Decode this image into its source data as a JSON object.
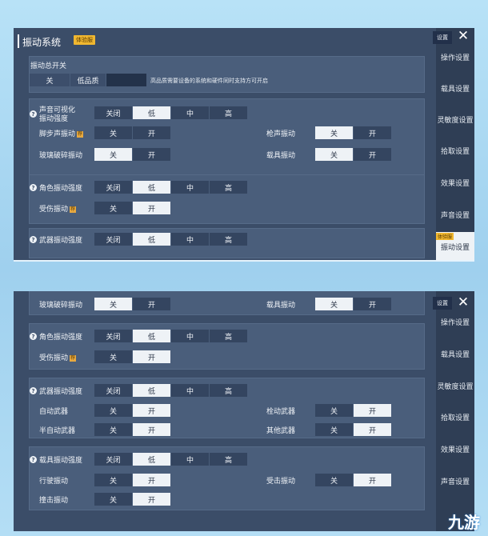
{
  "window": {
    "title": "振动系统",
    "badge": "体验服",
    "close_glyph": "✕"
  },
  "sidebar": {
    "top_button": "设置",
    "new_badge": "体验服",
    "items": [
      "操作设置",
      "载具设置",
      "灵敏度设置",
      "拾取设置",
      "效果设置",
      "声音设置",
      "振动设置"
    ]
  },
  "panel1": {
    "master": {
      "label": "振动总开关",
      "options": [
        "关",
        "低品质"
      ],
      "note": "高品质需要设备的系统和硬件同时支持方可开启"
    },
    "sound_visual": {
      "label_line1": "声音可视化",
      "label_line2": "振动强度",
      "levels": [
        "关闭",
        "低",
        "中",
        "高"
      ],
      "footstep": "脚步声振动",
      "gunshot": "枪声振动",
      "glass": "玻璃破碎振动",
      "vehicle": "载具振动"
    },
    "character": {
      "label": "角色振动强度",
      "levels": [
        "关闭",
        "低",
        "中",
        "高"
      ],
      "hit": "受伤振动"
    },
    "weapon": {
      "label": "武器振动强度",
      "levels": [
        "关闭",
        "低",
        "中",
        "高"
      ]
    }
  },
  "panel2": {
    "top_row": {
      "glass": "玻璃破碎振动",
      "vehicle": "载具振动"
    },
    "character": {
      "label": "角色振动强度",
      "levels": [
        "关闭",
        "低",
        "中",
        "高"
      ],
      "hit": "受伤振动"
    },
    "weapon": {
      "label": "武器振动强度",
      "levels": [
        "关闭",
        "低",
        "中",
        "高"
      ],
      "auto": "自动武器",
      "bolt": "栓动武器",
      "semi": "半自动武器",
      "other": "其他武器"
    },
    "vehicle": {
      "label": "载具振动强度",
      "levels": [
        "关闭",
        "低",
        "中",
        "高"
      ],
      "drive": "行驶振动",
      "hit_by": "受击振动",
      "crash": "撞击振动"
    }
  },
  "toggle": {
    "off": "关",
    "on": "开"
  },
  "help_glyph": "?",
  "badge_glyph": "荐",
  "watermark": "九游",
  "colors": {
    "panel": "#3b4d68",
    "section": "#4a5e7b",
    "selected": "#eef2f6",
    "accent_badge": "#f0b730"
  }
}
